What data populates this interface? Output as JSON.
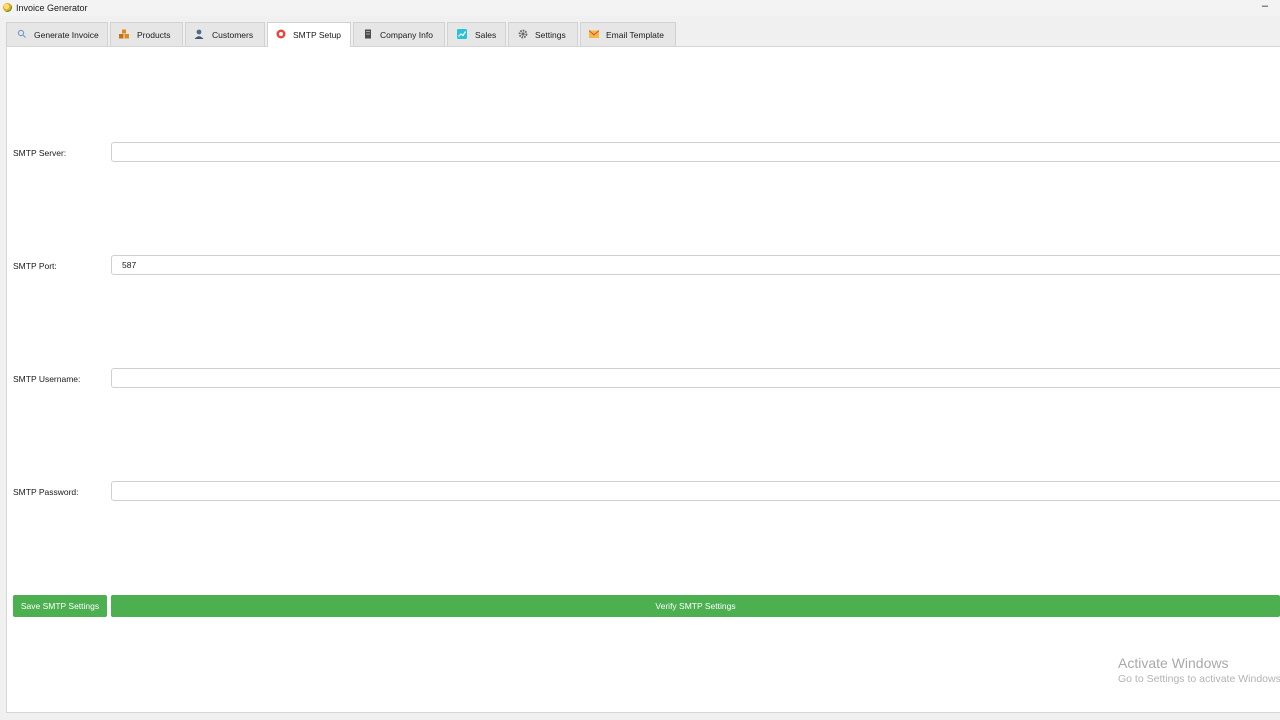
{
  "window": {
    "title": "Invoice Generator",
    "minimize_glyph": "–"
  },
  "tabs": [
    {
      "label": "Generate Invoice",
      "icon": "search-icon"
    },
    {
      "label": "Products",
      "icon": "boxes-icon"
    },
    {
      "label": "Customers",
      "icon": "customer-icon"
    },
    {
      "label": "SMTP Setup",
      "icon": "smtp-icon",
      "active": true
    },
    {
      "label": "Company Info",
      "icon": "building-icon"
    },
    {
      "label": "Sales",
      "icon": "chart-icon"
    },
    {
      "label": "Settings",
      "icon": "gear-icon"
    },
    {
      "label": "Email Template",
      "icon": "envelope-icon"
    }
  ],
  "form": {
    "server": {
      "label": "SMTP Server:",
      "value": ""
    },
    "port": {
      "label": "SMTP Port:",
      "value": "587"
    },
    "username": {
      "label": "SMTP Username:",
      "value": ""
    },
    "password": {
      "label": "SMTP Password:",
      "value": ""
    }
  },
  "buttons": {
    "save": "Save SMTP Settings",
    "verify": "Verify SMTP Settings"
  },
  "watermark": {
    "title": "Activate Windows",
    "subtitle": "Go to Settings to activate Windows."
  },
  "colors": {
    "accent": "#4caf50",
    "panel": "#ffffff",
    "window_bg": "#f0f0f0"
  }
}
